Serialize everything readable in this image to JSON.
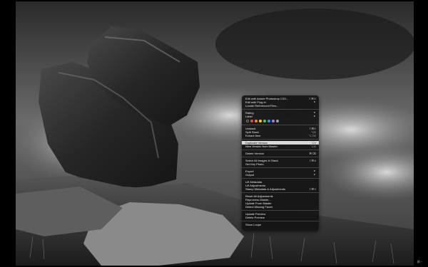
{
  "menu": {
    "items": [
      {
        "label": "Edit with Adobe Photoshop CS3...",
        "shortcut": "⇧⌘O"
      },
      {
        "label": "Edit with Plug-in",
        "shortcut": "►"
      },
      {
        "label": "Locate Referenced Files...",
        "shortcut": ""
      },
      {
        "label": "Rating",
        "shortcut": "►"
      },
      {
        "label": "Label",
        "shortcut": "►"
      },
      {
        "label": "Unstack",
        "shortcut": "⇧⌘K"
      },
      {
        "label": "Split Stack",
        "shortcut": "⌥K"
      },
      {
        "label": "Extract Item",
        "shortcut": "⌥⇧K"
      },
      {
        "label": "Duplicate Version",
        "shortcut": "⌥V"
      },
      {
        "label": "New Version from Master",
        "shortcut": "⌥G"
      },
      {
        "label": "Delete Version",
        "shortcut": "⌘⌫"
      },
      {
        "label": "Select All Images in Stack",
        "shortcut": "⇧⌘A"
      },
      {
        "label": "Set Key Photo",
        "shortcut": ""
      },
      {
        "label": "Export",
        "shortcut": "►"
      },
      {
        "label": "Output",
        "shortcut": "►"
      },
      {
        "label": "Lift Metadata",
        "shortcut": ""
      },
      {
        "label": "Lift Adjustments",
        "shortcut": ""
      },
      {
        "label": "Stamp Metadata & Adjustments",
        "shortcut": "⇧⌘V"
      },
      {
        "label": "Reset All Adjustments",
        "shortcut": ""
      },
      {
        "label": "Reprocess Master...",
        "shortcut": ""
      },
      {
        "label": "Update From Master",
        "shortcut": ""
      },
      {
        "label": "Detect Missing Faces",
        "shortcut": ""
      },
      {
        "label": "Update Preview",
        "shortcut": ""
      },
      {
        "label": "Delete Preview",
        "shortcut": ""
      },
      {
        "label": "Show Loupe",
        "shortcut": ""
      }
    ],
    "label_colors": [
      "#e5484d",
      "#f28c28",
      "#f2d024",
      "#4cc85b",
      "#3d8ef7",
      "#b67ce6",
      "#9aa0a6"
    ]
  }
}
